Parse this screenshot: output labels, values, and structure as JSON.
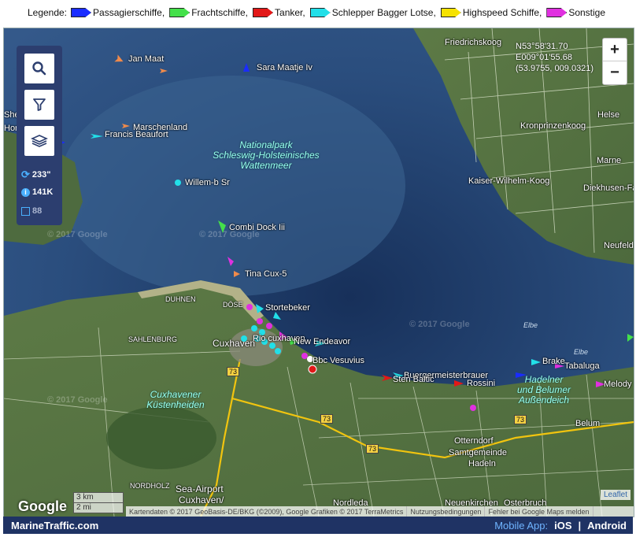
{
  "legend": {
    "prefix": "Legende:",
    "items": [
      {
        "label": "Passagierschiffe,",
        "color": "#1a2cff"
      },
      {
        "label": "Frachtschiffe,",
        "color": "#44e04a"
      },
      {
        "label": "Tanker,",
        "color": "#e21818"
      },
      {
        "label": "Schlepper Bagger Lotse,",
        "color": "#22dfe8"
      },
      {
        "label": "Highspeed Schiffe,",
        "color": "#f6e200"
      },
      {
        "label": "Sonstige",
        "color": "#e030e0"
      }
    ]
  },
  "controls": {
    "refresh_value": "233\"",
    "info_value": "141K",
    "box_value": "88"
  },
  "zoom": {
    "plus": "+",
    "minus": "−"
  },
  "coords": {
    "lat": "N53°58'31.70",
    "lon": "E009°01'55.68",
    "decimal": "(53.9755, 009.0321)"
  },
  "places": [
    "Friedrichskoog",
    "Helse",
    "Kronprinzenkoog",
    "Marne",
    "Kaiser-Wilhelm-Koog",
    "Diekhusen-Fa",
    "Neufeld",
    "DUHNEN",
    "DÖSE",
    "SAHLENBURG",
    "Cuxhaven",
    "Otterndorf",
    "Samtgemeinde",
    "Hadeln",
    "Belum",
    "NORDHOLZ",
    "Sea-Airport",
    "Cuxhaven/",
    "Nordleda",
    "Neuenkirchen",
    "Osterbruch",
    "She",
    "Hor"
  ],
  "roads": [
    "73",
    "73",
    "73",
    "73"
  ],
  "park": {
    "line1": "Nationalpark",
    "line2": "Schleswig-Holsteinisches",
    "line3": "Wattenmeer"
  },
  "heide": {
    "line1": "Cuxhavener",
    "line2": "Küstenheiden"
  },
  "hadelner": {
    "line1": "Hadelner",
    "line2": "und Belumer",
    "line3": "Außendeich"
  },
  "elbe": [
    "Elbe",
    "Elbe"
  ],
  "ships": [
    {
      "name": "Jan Maat",
      "color": "#f08a4b"
    },
    {
      "name": "Sara Maatje Iv",
      "color": "#1a2cff"
    },
    {
      "name": "Marschenland",
      "color": "#f08a4b"
    },
    {
      "name": "Francis Beaufort",
      "color": "#22dfe8"
    },
    {
      "name": "Willem-b Sr",
      "color": "#22dfe8"
    },
    {
      "name": "Combi Dock Iii",
      "color": "#44e04a"
    },
    {
      "name": "Tina Cux-5",
      "color": "#f08a4b"
    },
    {
      "name": "Stortebeker",
      "color": "#22dfe8"
    },
    {
      "name": "Rio cuxhaven",
      "color": "#22dfe8"
    },
    {
      "name": "New Endeavor",
      "color": "#44e04a"
    },
    {
      "name": "Bbc Vesuvius",
      "color": "#44e04a"
    },
    {
      "name": "Buergermeisterbrauer",
      "color": "#22dfe8"
    },
    {
      "name": "Sten Baltic",
      "color": "#e21818"
    },
    {
      "name": "Rossini",
      "color": "#e21818"
    },
    {
      "name": "Brake",
      "color": "#22dfe8"
    },
    {
      "name": "Tabaluga",
      "color": "#e030e0"
    },
    {
      "name": "Melody",
      "color": "#e030e0"
    }
  ],
  "watermark": "© 2017 Google",
  "google_logo": "Google",
  "scale": {
    "km": "3 km",
    "mi": "2 mi"
  },
  "attribution": [
    "Kartendaten © 2017 GeoBasis-DE/BKG (©2009), Google Grafiken © 2017 TerraMetrics",
    "Nutzungsbedingungen",
    "Fehler bei Google Maps melden"
  ],
  "leaflet": "Leaflet",
  "footer": {
    "brand": "MarineTraffic.com",
    "mobile": "Mobile App:",
    "ios": "iOS",
    "sep": "|",
    "android": "Android"
  }
}
